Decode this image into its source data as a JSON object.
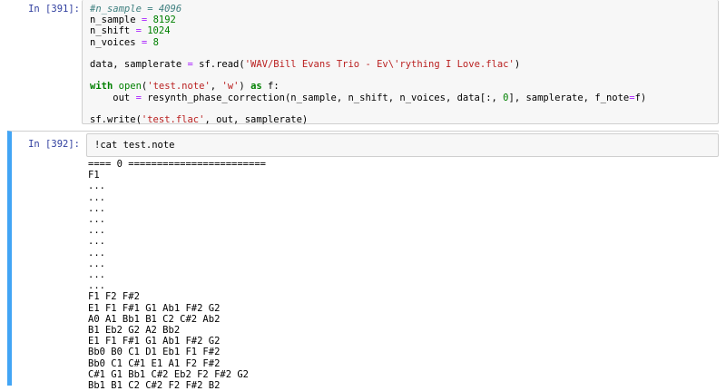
{
  "cell1": {
    "prompt": "In [391]:",
    "lines": [
      [
        {
          "t": "#n_sample = 4096",
          "c": "cmt"
        }
      ],
      [
        {
          "t": "n_sample ",
          "c": ""
        },
        {
          "t": "=",
          "c": "op"
        },
        {
          "t": " ",
          "c": ""
        },
        {
          "t": "8192",
          "c": "num"
        }
      ],
      [
        {
          "t": "n_shift ",
          "c": ""
        },
        {
          "t": "=",
          "c": "op"
        },
        {
          "t": " ",
          "c": ""
        },
        {
          "t": "1024",
          "c": "num"
        }
      ],
      [
        {
          "t": "n_voices ",
          "c": ""
        },
        {
          "t": "=",
          "c": "op"
        },
        {
          "t": " ",
          "c": ""
        },
        {
          "t": "8",
          "c": "num"
        }
      ],
      [],
      [
        {
          "t": "data, samplerate ",
          "c": ""
        },
        {
          "t": "=",
          "c": "op"
        },
        {
          "t": " sf.read(",
          "c": ""
        },
        {
          "t": "'WAV/Bill Evans Trio - Ev\\'rything I Love.flac'",
          "c": "str"
        },
        {
          "t": ")",
          "c": ""
        }
      ],
      [],
      [
        {
          "t": "with",
          "c": "kw"
        },
        {
          "t": " ",
          "c": ""
        },
        {
          "t": "open",
          "c": "num"
        },
        {
          "t": "(",
          "c": ""
        },
        {
          "t": "'test.note'",
          "c": "str"
        },
        {
          "t": ", ",
          "c": ""
        },
        {
          "t": "'w'",
          "c": "str"
        },
        {
          "t": ") ",
          "c": ""
        },
        {
          "t": "as",
          "c": "kw"
        },
        {
          "t": " f:",
          "c": ""
        }
      ],
      [
        {
          "t": "    out ",
          "c": ""
        },
        {
          "t": "=",
          "c": "op"
        },
        {
          "t": " resynth_phase_correction(n_sample, n_shift, n_voices, data[:, ",
          "c": ""
        },
        {
          "t": "0",
          "c": "num"
        },
        {
          "t": "], samplerate, f_note",
          "c": ""
        },
        {
          "t": "=",
          "c": "op"
        },
        {
          "t": "f)",
          "c": ""
        }
      ],
      [],
      [
        {
          "t": "sf.write(",
          "c": ""
        },
        {
          "t": "'test.flac'",
          "c": "str"
        },
        {
          "t": ", out, samplerate)",
          "c": ""
        }
      ]
    ]
  },
  "cell2": {
    "prompt": "In [392]:",
    "input": [
      {
        "t": "!cat test.note",
        "c": ""
      }
    ],
    "output": [
      "==== 0 ========================",
      "F1",
      "...",
      "...",
      "...",
      "...",
      "...",
      "...",
      "...",
      "...",
      "...",
      "...",
      "F1 F2 F#2",
      "E1 F1 F#1 G1 Ab1 F#2 G2",
      "A0 A1 Bb1 B1 C2 C#2 Ab2",
      "B1 Eb2 G2 A2 Bb2",
      "E1 F1 F#1 G1 Ab1 F#2 G2",
      "Bb0 B0 C1 D1 Eb1 F1 F#2",
      "Bb0 C1 C#1 E1 A1 F2 F#2",
      "C#1 G1 Bb1 C#2 Eb2 F2 F#2 G2",
      "Bb1 B1 C2 C#2 F2 F#2 B2"
    ]
  }
}
